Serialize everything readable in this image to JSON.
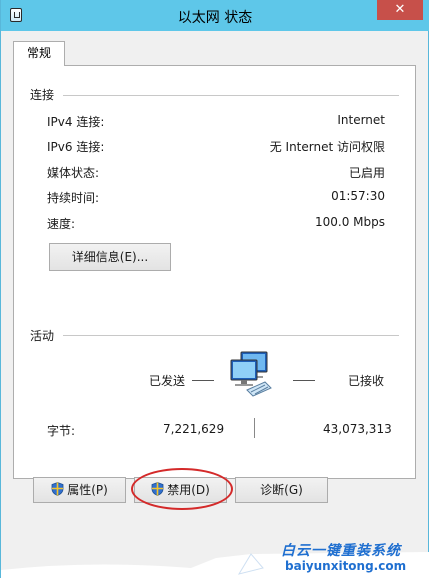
{
  "window": {
    "title": "以太网 状态",
    "close_label": "✕"
  },
  "tabs": [
    {
      "label": "常规"
    }
  ],
  "connection": {
    "header": "连接",
    "rows": [
      {
        "label": "IPv4 连接:",
        "value": "Internet"
      },
      {
        "label": "IPv6 连接:",
        "value": "无 Internet 访问权限"
      },
      {
        "label": "媒体状态:",
        "value": "已启用"
      },
      {
        "label": "持续时间:",
        "value": "01:57:30"
      },
      {
        "label": "速度:",
        "value": "100.0 Mbps"
      }
    ],
    "details_button": "详细信息(E)..."
  },
  "activity": {
    "header": "活动",
    "sent_label": "已发送",
    "received_label": "已接收",
    "bytes_label": "字节:",
    "bytes_sent": "7,221,629",
    "bytes_received": "43,073,313"
  },
  "buttons": {
    "properties": "属性(P)",
    "disable": "禁用(D)",
    "diagnose": "诊断(G)"
  },
  "watermark": {
    "brand": "白云一键重装系统",
    "url": "baiyunxitong.com"
  },
  "icons": {
    "window": "network-window-icon",
    "network": "network-computers-icon",
    "shield": "uac-shield-icon"
  },
  "colors": {
    "titlebar": "#5ec7e9",
    "close": "#c7504a",
    "highlight": "#d42a2a",
    "watermark_text": "#1f6fd0"
  }
}
